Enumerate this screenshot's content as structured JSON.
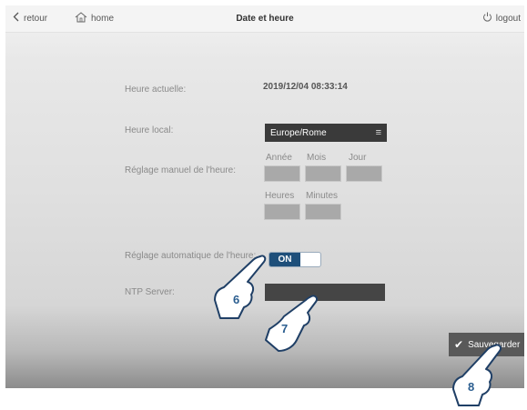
{
  "topbar": {
    "back_label": "retour",
    "home_label": "home",
    "title": "Date et heure",
    "logout_label": "logout"
  },
  "form": {
    "current_time_label": "Heure actuelle:",
    "current_time_value": "2019/12/04 08:33:14",
    "local_time_label": "Heure local:",
    "timezone_value": "Europe/Rome",
    "manual_label": "Réglage manuel de l'heure:",
    "year_label": "Année",
    "month_label": "Mois",
    "day_label": "Jour",
    "hours_label": "Heures",
    "minutes_label": "Minutes",
    "auto_label": "Réglage automatique de l'heure:",
    "auto_toggle_value": "ON",
    "ntp_label": "NTP Server:"
  },
  "save_button": {
    "label": "Sauvegarder"
  },
  "callouts": [
    "6",
    "7",
    "8"
  ]
}
